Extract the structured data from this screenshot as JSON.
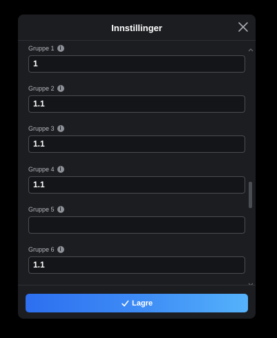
{
  "modal": {
    "title": "Innstillinger",
    "close_icon": "close-icon",
    "save_label": "Lagre",
    "save_icon": "check-icon"
  },
  "fields": [
    {
      "label": "Gruppe 1",
      "value": "1"
    },
    {
      "label": "Gruppe 2",
      "value": "1.1"
    },
    {
      "label": "Gruppe 3",
      "value": "1.1"
    },
    {
      "label": "Gruppe 4",
      "value": "1.1"
    },
    {
      "label": "Gruppe 5",
      "value": ""
    },
    {
      "label": "Gruppe 6",
      "value": "1.1"
    }
  ],
  "colors": {
    "background": "#000000",
    "modal": "#1c1d21",
    "input_bg": "#141518",
    "input_border": "#4a4d54",
    "accent_start": "#2d6ff0",
    "accent_end": "#55b2fb"
  }
}
